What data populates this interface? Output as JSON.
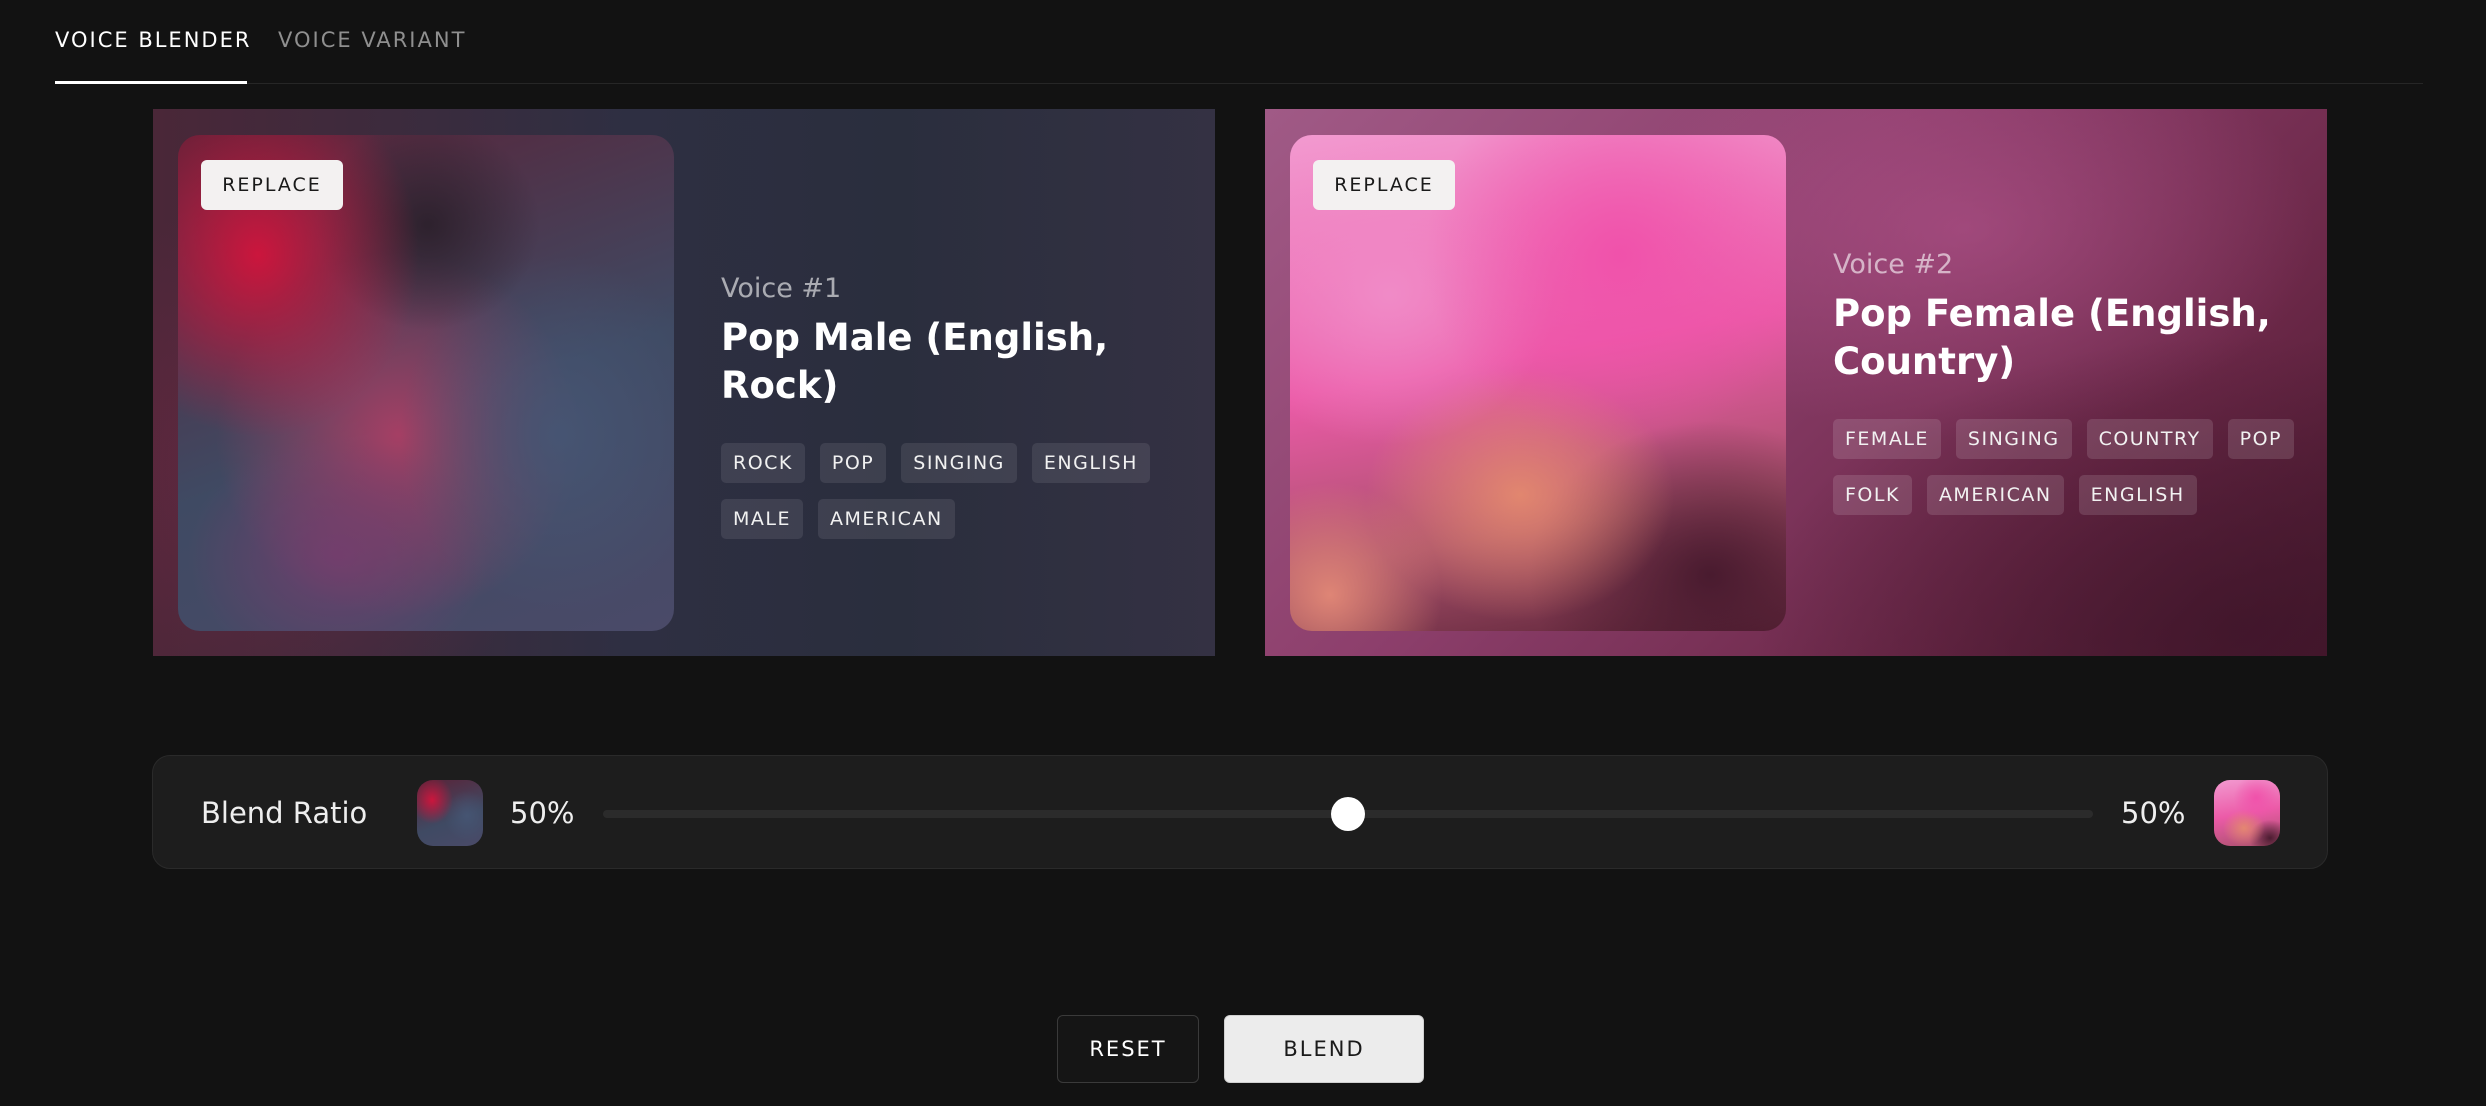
{
  "tabs": [
    {
      "label": "VOICE BLENDER",
      "active": true
    },
    {
      "label": "VOICE VARIANT",
      "active": false
    }
  ],
  "voices": [
    {
      "replace_label": "REPLACE",
      "number": "Voice #1",
      "name": "Pop Male (English, Rock)",
      "tags": [
        "ROCK",
        "POP",
        "SINGING",
        "ENGLISH",
        "MALE",
        "AMERICAN"
      ]
    },
    {
      "replace_label": "REPLACE",
      "number": "Voice #2",
      "name": "Pop Female (English, Country)",
      "tags": [
        "FEMALE",
        "SINGING",
        "COUNTRY",
        "POP",
        "FOLK",
        "AMERICAN",
        "ENGLISH"
      ]
    }
  ],
  "blend": {
    "label": "Blend Ratio",
    "left_percent": "50%",
    "right_percent": "50%",
    "slider_value": 0.5
  },
  "actions": {
    "reset_label": "RESET",
    "blend_label": "BLEND"
  },
  "colors": {
    "background": "#121212",
    "panel": "#1d1d1d",
    "slider_thumb": "#ffffff"
  }
}
